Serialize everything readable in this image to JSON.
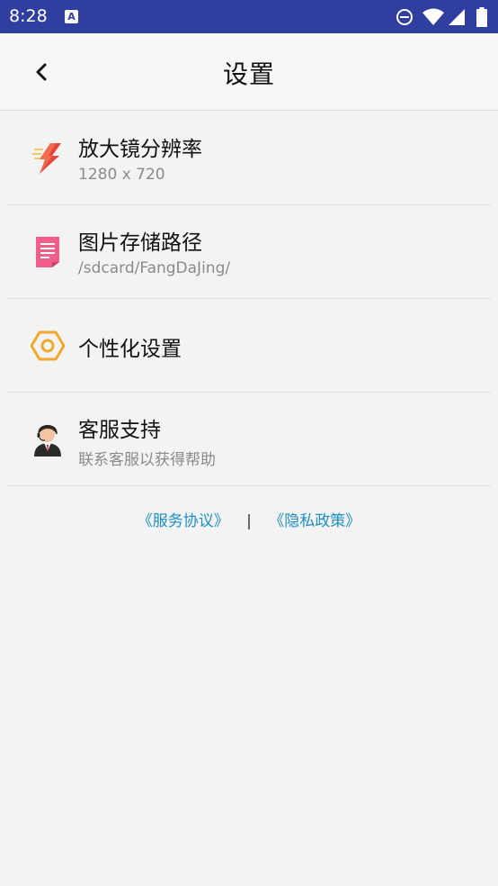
{
  "status_bar": {
    "time": "8:28",
    "notification_icon": "A",
    "icons": [
      "do-not-disturb-icon",
      "wifi-icon",
      "signal-icon",
      "battery-icon"
    ],
    "color": "#303f9f"
  },
  "toolbar": {
    "title": "设置",
    "back_icon": "chevron-left-icon"
  },
  "settings": [
    {
      "title": "放大镜分辨率",
      "subtitle": "1280 x 720",
      "icon": "lightning-icon"
    },
    {
      "title": "图片存储路径",
      "subtitle": "/sdcard/FangDaJing/",
      "icon": "document-icon"
    },
    {
      "title": "个性化设置",
      "icon": "hexagon-settings-icon"
    },
    {
      "title": "客服支持",
      "subtitle": "联系客服以获得帮助",
      "icon": "customer-service-icon"
    }
  ],
  "footer": {
    "terms": "《服务协议》",
    "separator": "|",
    "privacy": "《隐私政策》",
    "link_color": "#1d8fc4"
  }
}
